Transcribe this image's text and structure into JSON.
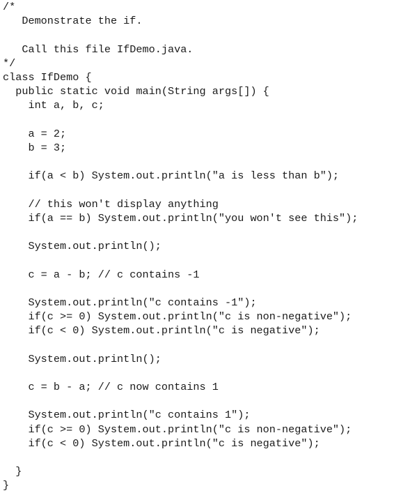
{
  "code": {
    "lines": [
      "/*",
      "   Demonstrate the if.",
      "",
      "   Call this file IfDemo.java.",
      "*/",
      "class IfDemo {",
      "  public static void main(String args[]) {",
      "    int a, b, c;",
      "",
      "    a = 2;",
      "    b = 3;",
      "",
      "    if(a < b) System.out.println(\"a is less than b\");",
      "",
      "    // this won't display anything",
      "    if(a == b) System.out.println(\"you won't see this\");",
      "",
      "    System.out.println();",
      "",
      "    c = a - b; // c contains -1",
      "",
      "    System.out.println(\"c contains -1\");",
      "    if(c >= 0) System.out.println(\"c is non-negative\");",
      "    if(c < 0) System.out.println(\"c is negative\");",
      "",
      "    System.out.println();",
      "",
      "    c = b - a; // c now contains 1",
      "",
      "    System.out.println(\"c contains 1\");",
      "    if(c >= 0) System.out.println(\"c is non-negative\");",
      "    if(c < 0) System.out.println(\"c is negative\");",
      "",
      "  }",
      "}"
    ]
  }
}
